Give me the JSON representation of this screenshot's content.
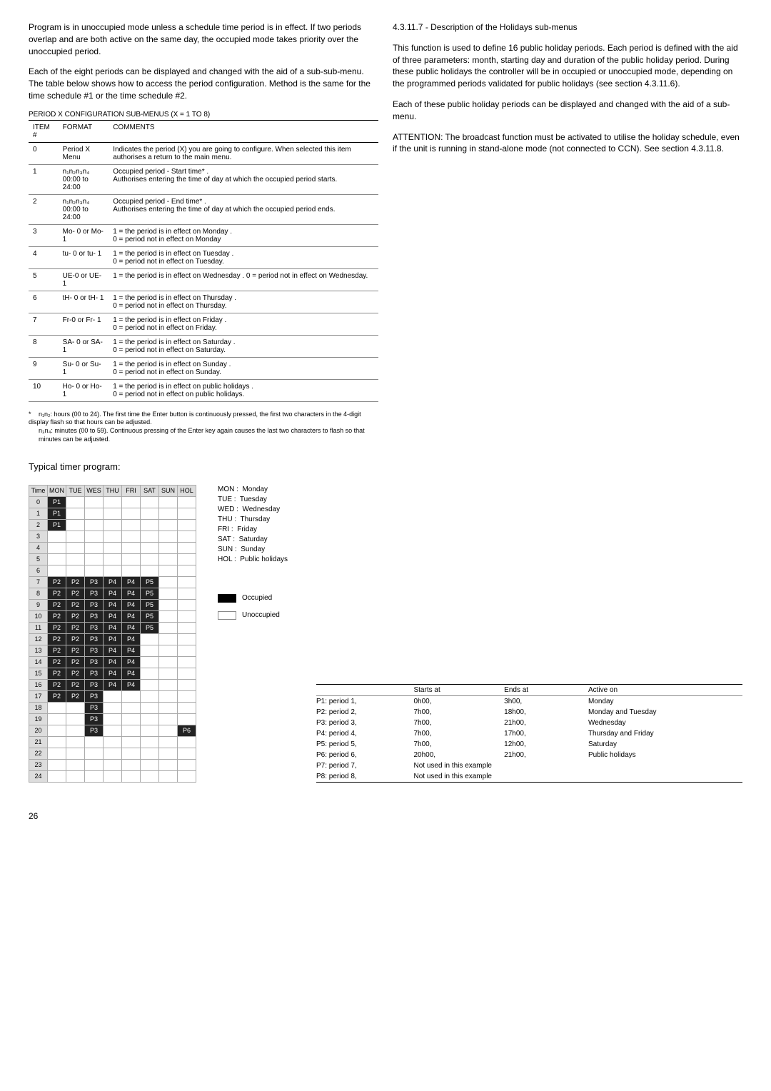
{
  "left": {
    "p1": "Program is in unoccupied mode unless a schedule time period is in effect. If two periods overlap and are both active on the same day, the occupied mode takes priority over the unoccupied period.",
    "p2": "Each of the eight periods can be displayed and changed with the aid of a sub-sub-menu. The table below shows how to access the period configuration. Method is the same for the time schedule #1 or the time schedule #2.",
    "table_caption": "PERIOD X CONFIGURATION SUB-MENUS (X = 1 TO 8)",
    "th_item": "ITEM #",
    "th_format": "FORMAT",
    "th_comments": "COMMENTS",
    "rows": [
      {
        "i": "0",
        "f": "Period X Menu",
        "c": "Indicates the period (X) you are going to configure. When selected this item authorises a return to the main menu."
      },
      {
        "i": "1",
        "f": "n₁n₂n₃n₄\n00:00 to 24:00",
        "c": "Occupied period - Start time*   .\nAuthorises entering the time of day at which the occupied period starts."
      },
      {
        "i": "2",
        "f": "n₁n₂n₃n₄\n00:00 to 24:00",
        "c": "Occupied period - End time*   .\nAuthorises entering the time of day at which the occupied period ends."
      },
      {
        "i": "3",
        "f": "Mo- 0 or Mo- 1",
        "c": "1 = the period is in effect on Monday .\n0 = period not in effect on Monday"
      },
      {
        "i": "4",
        "f": "tu- 0 or tu- 1",
        "c": "1 = the period is in effect on Tuesday .\n0 = period not in effect on Tuesday."
      },
      {
        "i": "5",
        "f": "UE-0 or UE- 1",
        "c": "1 = the period is in effect on Wednesday . 0 = period not in effect on Wednesday."
      },
      {
        "i": "6",
        "f": "tH- 0 or tH- 1",
        "c": "1 = the period is in effect on Thursday .\n0 = period not in effect on Thursday."
      },
      {
        "i": "7",
        "f": "Fr-0 or Fr- 1",
        "c": "1 = the period is in effect on Friday .\n0 = period not in effect on Friday."
      },
      {
        "i": "8",
        "f": "SA- 0 or SA- 1",
        "c": "1 = the period is in effect on Saturday .\n0 = period not in effect on Saturday."
      },
      {
        "i": "9",
        "f": "Su- 0 or Su- 1",
        "c": "1 = the period is in effect on Sunday .\n0 = period not in effect on Sunday."
      },
      {
        "i": "10",
        "f": "Ho- 0 or Ho- 1",
        "c": "1 = the period is in effect on public  holidays .\n0 = period not in effect on public holidays."
      }
    ],
    "footnote_ast": "*",
    "footnote1": "n₁n₂: hours (00 to 24). The first time the Enter button is continuously pressed, the first two characters in the 4-digit display flash so that hours can be adjusted.",
    "footnote2": "n₃n₄: minutes (00 to 59). Continuous pressing of the Enter key again causes the last two characters to flash so that minutes can be adjusted.",
    "typical_title": "Typical timer program:"
  },
  "right": {
    "heading": "4.3.11.7 - Description of the Holidays sub-menus",
    "p1": "This function is used to define 16 public holiday periods. Each period is defined with the aid of three parameters: month, starting day and duration of the public holiday period. During these public holidays the controller will be in occupied or unoccupied mode, depending on the programmed periods validated for public holidays (see section 4.3.11.6).",
    "p2": "Each of these public holiday periods can be displayed and changed with the aid of a sub-menu.",
    "p3": "ATTENTION: The broadcast function must be activated to utilise the holiday schedule, even if the unit is running in stand-alone mode (not connected to CCN). See section 4.3.11.8."
  },
  "chart_data": {
    "type": "table",
    "title": "Typical timer program",
    "days": [
      "MON",
      "TUE",
      "WES",
      "THU",
      "FRI",
      "SAT",
      "SUN",
      "HOL"
    ],
    "hours": [
      "0",
      "1",
      "2",
      "3",
      "4",
      "5",
      "6",
      "7",
      "8",
      "9",
      "10",
      "11",
      "12",
      "13",
      "14",
      "15",
      "16",
      "17",
      "18",
      "19",
      "20",
      "21",
      "22",
      "23",
      "24"
    ],
    "grid": [
      [
        "P1",
        "",
        "",
        "",
        "",
        "",
        "",
        ""
      ],
      [
        "P1",
        "",
        "",
        "",
        "",
        "",
        "",
        ""
      ],
      [
        "P1",
        "",
        "",
        "",
        "",
        "",
        "",
        ""
      ],
      [
        "",
        "",
        "",
        "",
        "",
        "",
        "",
        ""
      ],
      [
        "",
        "",
        "",
        "",
        "",
        "",
        "",
        ""
      ],
      [
        "",
        "",
        "",
        "",
        "",
        "",
        "",
        ""
      ],
      [
        "",
        "",
        "",
        "",
        "",
        "",
        "",
        ""
      ],
      [
        "P2",
        "P2",
        "P3",
        "P4",
        "P4",
        "P5",
        "",
        ""
      ],
      [
        "P2",
        "P2",
        "P3",
        "P4",
        "P4",
        "P5",
        "",
        ""
      ],
      [
        "P2",
        "P2",
        "P3",
        "P4",
        "P4",
        "P5",
        "",
        ""
      ],
      [
        "P2",
        "P2",
        "P3",
        "P4",
        "P4",
        "P5",
        "",
        ""
      ],
      [
        "P2",
        "P2",
        "P3",
        "P4",
        "P4",
        "P5",
        "",
        ""
      ],
      [
        "P2",
        "P2",
        "P3",
        "P4",
        "P4",
        "",
        "",
        ""
      ],
      [
        "P2",
        "P2",
        "P3",
        "P4",
        "P4",
        "",
        "",
        ""
      ],
      [
        "P2",
        "P2",
        "P3",
        "P4",
        "P4",
        "",
        "",
        ""
      ],
      [
        "P2",
        "P2",
        "P3",
        "P4",
        "P4",
        "",
        "",
        ""
      ],
      [
        "P2",
        "P2",
        "P3",
        "P4",
        "P4",
        "",
        "",
        ""
      ],
      [
        "P2",
        "P2",
        "P3",
        "",
        "",
        "",
        "",
        ""
      ],
      [
        "",
        "",
        "P3",
        "",
        "",
        "",
        "",
        ""
      ],
      [
        "",
        "",
        "P3",
        "",
        "",
        "",
        "",
        ""
      ],
      [
        "",
        "",
        "P3",
        "",
        "",
        "",
        "",
        "P6"
      ],
      [
        "",
        "",
        "",
        "",
        "",
        "",
        "",
        ""
      ],
      [
        "",
        "",
        "",
        "",
        "",
        "",
        "",
        ""
      ],
      [
        "",
        "",
        "",
        "",
        "",
        "",
        "",
        ""
      ],
      [
        "",
        "",
        "",
        "",
        "",
        "",
        "",
        ""
      ]
    ]
  },
  "day_legend": [
    [
      "MON :",
      "Monday"
    ],
    [
      "TUE :",
      "Tuesday"
    ],
    [
      "WED :",
      "Wednesday"
    ],
    [
      "THU :",
      "Thursday"
    ],
    [
      "FRI :",
      "Friday"
    ],
    [
      "SAT :",
      "Saturday"
    ],
    [
      "SUN :",
      "Sunday"
    ],
    [
      "HOL :",
      "Public holidays"
    ]
  ],
  "occ_legend": {
    "occ": "Occupied",
    "unocc": "Unoccupied"
  },
  "summary": {
    "th_starts": "Starts at",
    "th_ends": "Ends at",
    "th_active": "Active on",
    "rows": [
      {
        "p": "P1: period 1,",
        "s": "0h00,",
        "e": "3h00,",
        "a": "Monday"
      },
      {
        "p": "P2: period 2,",
        "s": "7h00,",
        "e": "18h00,",
        "a": "Monday and Tuesday"
      },
      {
        "p": "P3: period 3,",
        "s": "7h00,",
        "e": "21h00,",
        "a": "Wednesday"
      },
      {
        "p": "P4: period 4,",
        "s": "7h00,",
        "e": "17h00,",
        "a": "Thursday and Friday"
      },
      {
        "p": "P5: period 5,",
        "s": "7h00,",
        "e": "12h00,",
        "a": "Saturday"
      },
      {
        "p": "P6: period 6,",
        "s": "20h00,",
        "e": "21h00,",
        "a": "Public holidays"
      },
      {
        "p": "P7: period 7,",
        "s": "Not used in this example",
        "e": "",
        "a": ""
      },
      {
        "p": "P8: period 8,",
        "s": "Not used in this example",
        "e": "",
        "a": ""
      }
    ]
  },
  "page_num": "26"
}
